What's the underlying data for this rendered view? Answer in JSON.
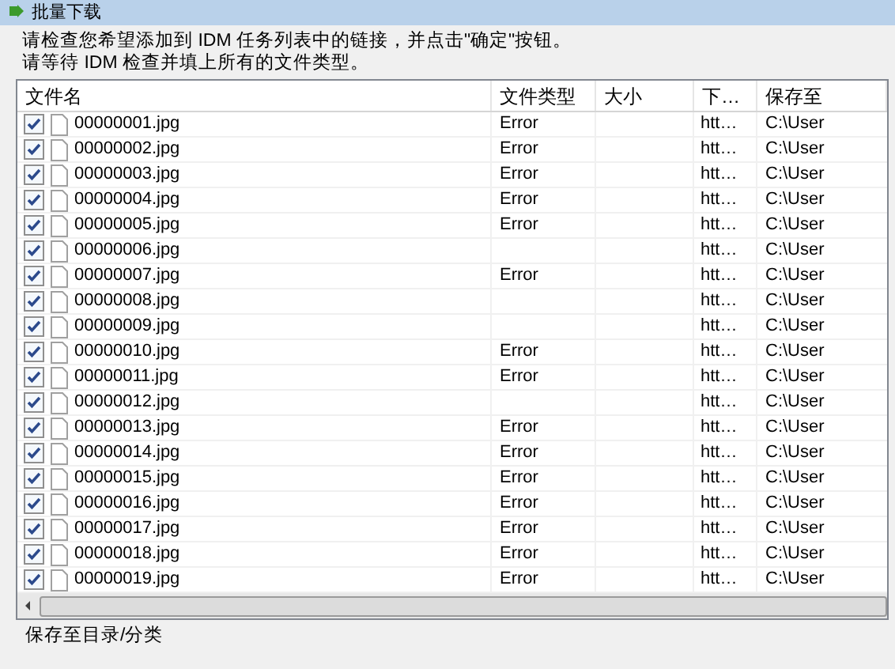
{
  "window": {
    "title": "批量下载"
  },
  "instructions": [
    "请检查您希望添加到 IDM 任务列表中的链接，并点击\"确定\"按钮。",
    "请等待 IDM 检查并填上所有的文件类型。"
  ],
  "table": {
    "columns": [
      "文件名",
      "文件类型",
      "大小",
      "下…",
      "保存至"
    ],
    "rows": [
      {
        "checked": true,
        "name": "00000001.jpg",
        "type": "Error",
        "url": "htt…",
        "path": "C:\\User"
      },
      {
        "checked": true,
        "name": "00000002.jpg",
        "type": "Error",
        "url": "htt…",
        "path": "C:\\User"
      },
      {
        "checked": true,
        "name": "00000003.jpg",
        "type": "Error",
        "url": "htt…",
        "path": "C:\\User"
      },
      {
        "checked": true,
        "name": "00000004.jpg",
        "type": "Error",
        "url": "htt…",
        "path": "C:\\User"
      },
      {
        "checked": true,
        "name": "00000005.jpg",
        "type": "Error",
        "url": "htt…",
        "path": "C:\\User"
      },
      {
        "checked": true,
        "name": "00000006.jpg",
        "url": "htt…",
        "path": "C:\\User"
      },
      {
        "checked": true,
        "name": "00000007.jpg",
        "type": "Error",
        "url": "htt…",
        "path": "C:\\User"
      },
      {
        "checked": true,
        "name": "00000008.jpg",
        "url": "htt…",
        "path": "C:\\User"
      },
      {
        "checked": true,
        "name": "00000009.jpg",
        "url": "htt…",
        "path": "C:\\User"
      },
      {
        "checked": true,
        "name": "00000010.jpg",
        "type": "Error",
        "url": "htt…",
        "path": "C:\\User"
      },
      {
        "checked": true,
        "name": "00000011.jpg",
        "type": "Error",
        "url": "htt…",
        "path": "C:\\User"
      },
      {
        "checked": true,
        "name": "00000012.jpg",
        "url": "htt…",
        "path": "C:\\User"
      },
      {
        "checked": true,
        "name": "00000013.jpg",
        "type": "Error",
        "url": "htt…",
        "path": "C:\\User"
      },
      {
        "checked": true,
        "name": "00000014.jpg",
        "type": "Error",
        "url": "htt…",
        "path": "C:\\User"
      },
      {
        "checked": true,
        "name": "00000015.jpg",
        "type": "Error",
        "url": "htt…",
        "path": "C:\\User"
      },
      {
        "checked": true,
        "name": "00000016.jpg",
        "type": "Error",
        "url": "htt…",
        "path": "C:\\User"
      },
      {
        "checked": true,
        "name": "00000017.jpg",
        "type": "Error",
        "url": "htt…",
        "path": "C:\\User"
      },
      {
        "checked": true,
        "name": "00000018.jpg",
        "type": "Error",
        "url": "htt…",
        "path": "C:\\User"
      },
      {
        "checked": true,
        "name": "00000019.jpg",
        "type": "Error",
        "url": "htt…",
        "path": "C:\\User"
      }
    ]
  },
  "footer_label": "保存至目录/分类"
}
